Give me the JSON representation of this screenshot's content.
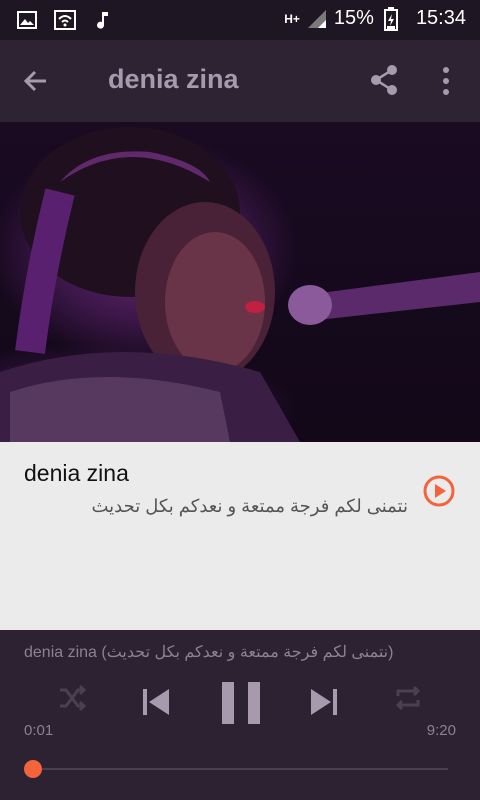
{
  "status_bar": {
    "battery_percent": "15%",
    "time": "15:34",
    "network": "H+",
    "icons": [
      "image-icon",
      "wifi-icon",
      "music-note-icon",
      "signal-icon",
      "battery-icon"
    ]
  },
  "appbar": {
    "title": "denia zina",
    "icons": [
      "back-arrow-icon",
      "share-icon",
      "more-vert-icon"
    ]
  },
  "item": {
    "title": "denia zina",
    "description": "نتمنى لكم فرجة ممتعة و نعدكم بكل تحديث"
  },
  "player": {
    "now_playing": "denia zina (نتمنى لكم فرجة ممتعة و نعدكم بكل تحديث)",
    "current_time": "0:01",
    "total_time": "9:20",
    "progress": 0.0018,
    "controls": [
      "shuffle-icon",
      "skip-previous-icon",
      "pause-icon",
      "skip-next-icon",
      "repeat-icon"
    ]
  },
  "colors": {
    "accent": "#f4643c",
    "appbar": "#2e2333",
    "player_bg": "#2c2231",
    "card_bg": "#ebebeb"
  }
}
